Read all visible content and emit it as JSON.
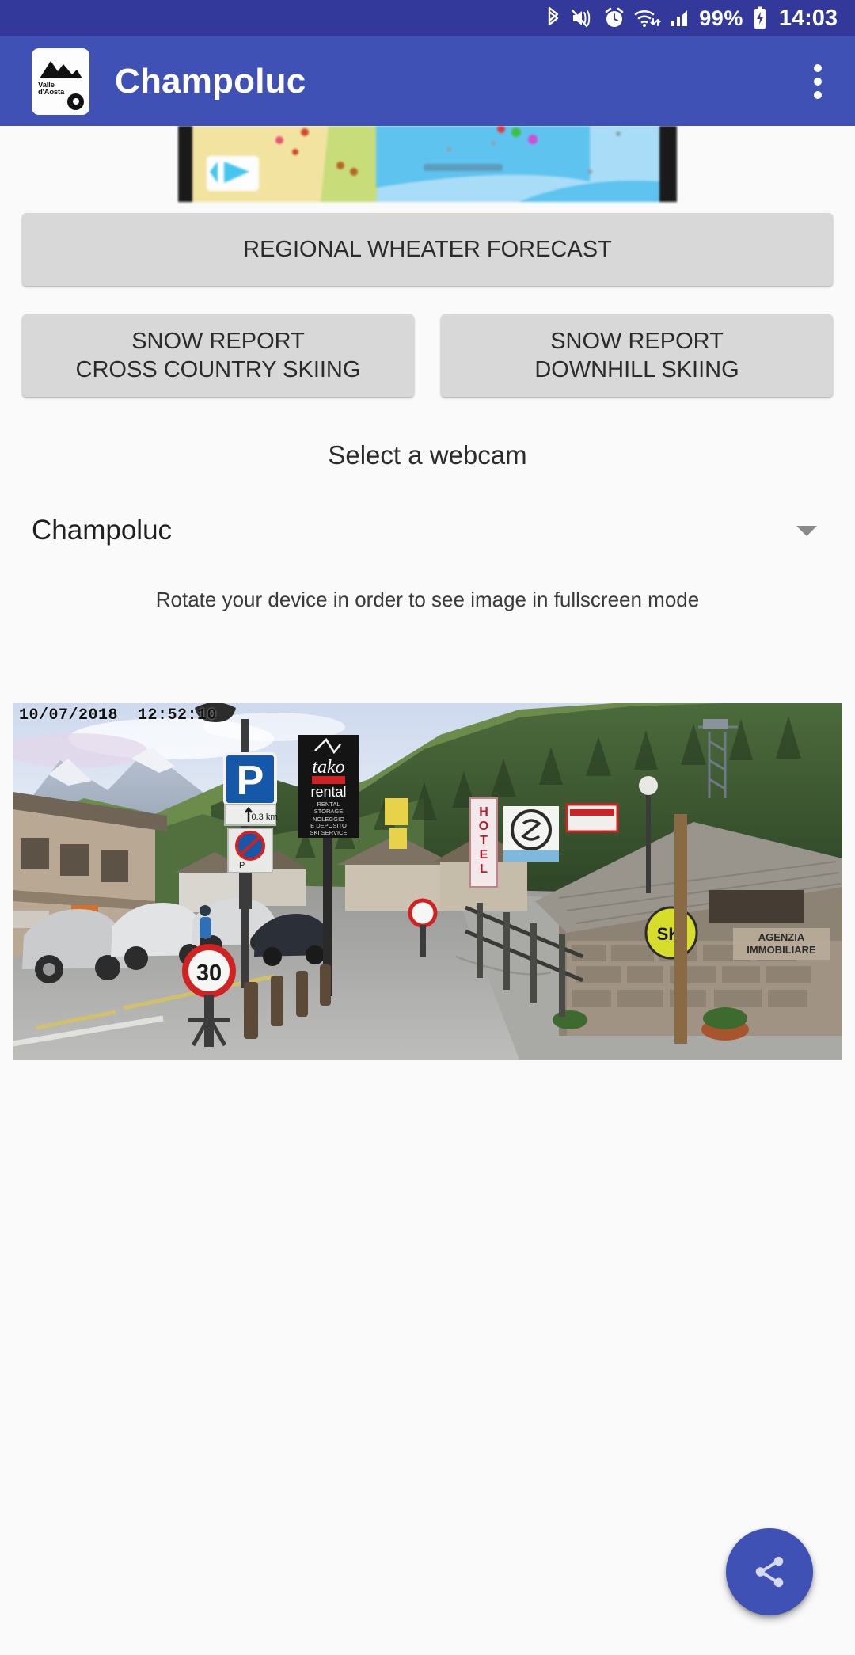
{
  "status_bar": {
    "icons": [
      "bluetooth-icon",
      "mute-vibrate-icon",
      "alarm-clock-icon",
      "wifi-icon",
      "cellular-signal-icon"
    ],
    "battery_percent": "99%",
    "battery_icon": "battery-charging-icon",
    "time": "14:03",
    "background_color": "#32399b"
  },
  "app_bar": {
    "title": "Champoluc",
    "logo_text_line1": "Valle",
    "logo_text_line2": "d'Aosta",
    "logo_icon": "mountain-logo-icon",
    "overflow_icon": "overflow-menu-icon",
    "background_color": "#3f51b5"
  },
  "main": {
    "map_thumbnail_name": "regional-map-thumbnail",
    "forecast_button": "REGIONAL WHEATER FORECAST",
    "snow_cross_country_button": "SNOW REPORT\nCROSS COUNTRY SKIING",
    "snow_downhill_button": "SNOW REPORT\nDOWNHILL SKIING",
    "select_webcam_label": "Select a webcam",
    "webcam_selected": "Champoluc",
    "webcam_options": [
      "Champoluc"
    ],
    "rotate_hint": "Rotate your device in order to see image in fullscreen mode",
    "webcam_timestamp": "10/07/2018  12:52:10",
    "webcam_scene_signs": {
      "parking_sign": "P",
      "parking_distance": "0.3 km",
      "rental_sign_brand": "tako",
      "rental_sign_word": "rental",
      "rental_sign_lines": "RENTAL STORAGE NOLEGGIO E DEPOSITO SKI SERVICE",
      "hotel_sign": "HOTEL",
      "ski_sign": "SKI",
      "agency_sign_line1": "AGENZIA",
      "agency_sign_line2": "IMMOBILIARE",
      "speed_limit": "30"
    }
  },
  "fab": {
    "icon": "share-icon",
    "color": "#3f51b5"
  }
}
